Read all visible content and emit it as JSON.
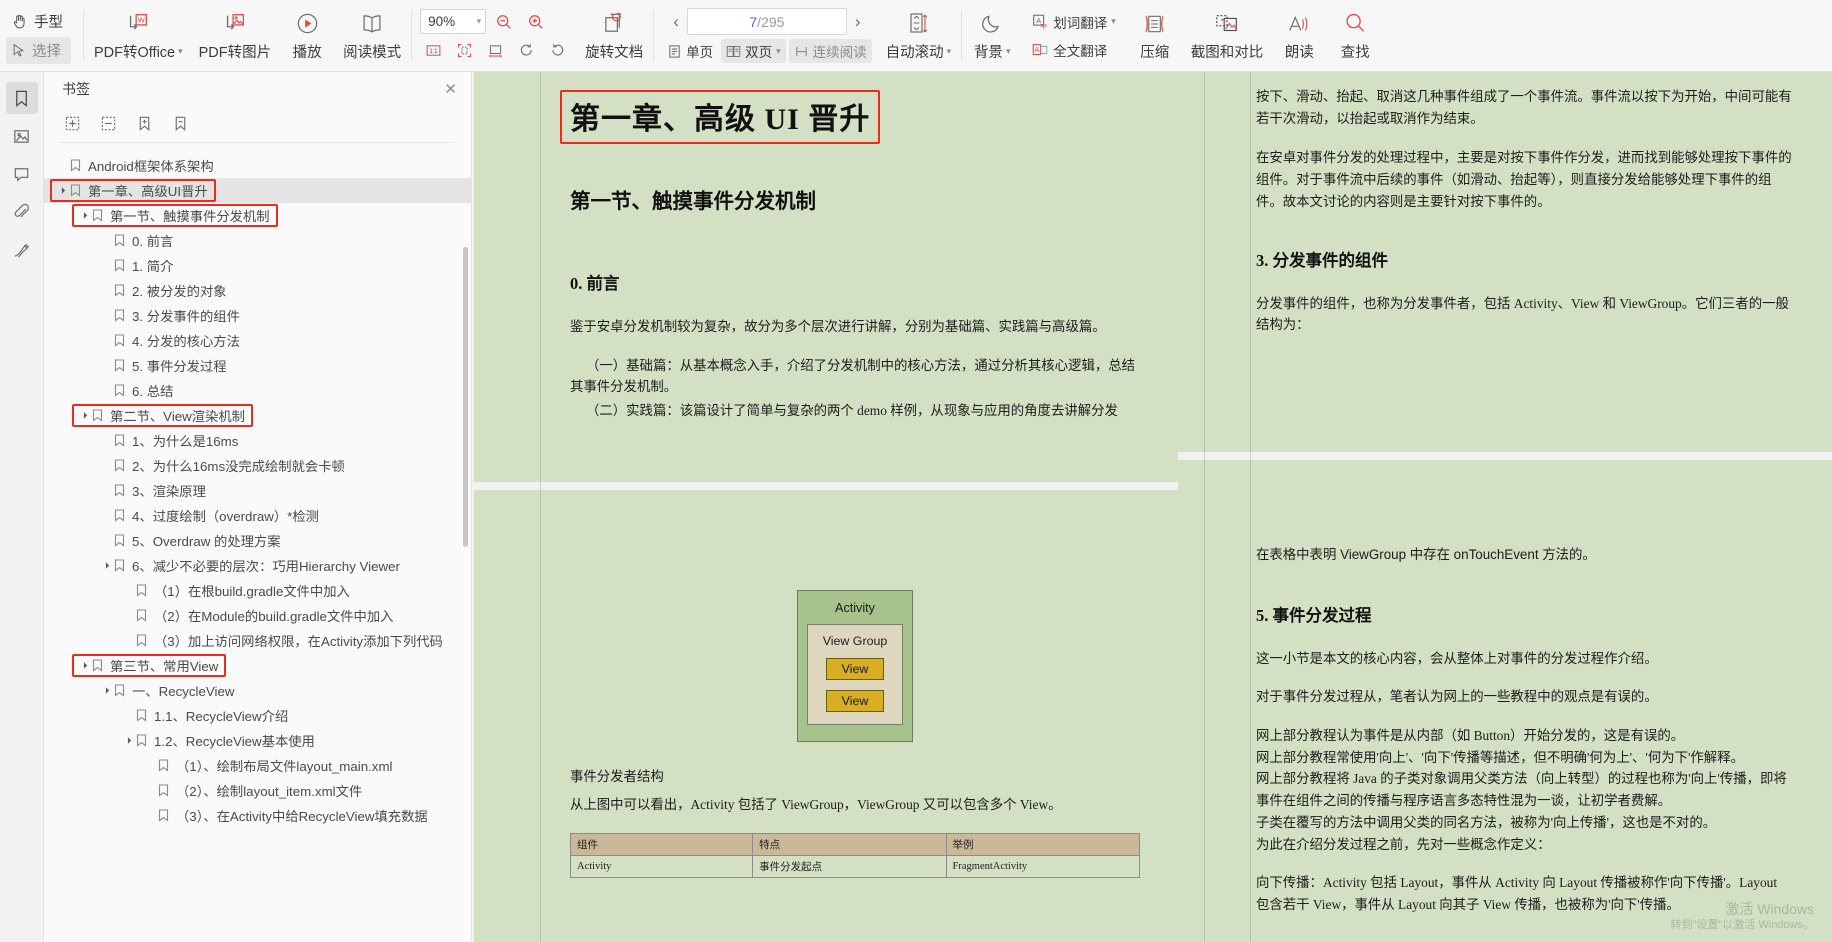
{
  "toolbar": {
    "mode_hand": "手型",
    "mode_select": "选择",
    "pdf_to_office": "PDF转Office",
    "pdf_to_image": "PDF转图片",
    "play": "播放",
    "read_mode": "阅读模式",
    "zoom_value": "90%",
    "zoom_out_title": "缩小",
    "zoom_in_title": "放大",
    "fit_actual": "1:1",
    "rotate_doc": "旋转文档",
    "page_current": "7",
    "page_separator": "/",
    "page_total": "295",
    "single_page": "单页",
    "double_page": "双页",
    "continuous_read": "连续阅读",
    "auto_scroll": "自动滚动",
    "background": "背景",
    "word_translate": "划词翻译",
    "full_translate": "全文翻译",
    "compress": "压缩",
    "screenshot_compare": "截图和对比",
    "read_aloud": "朗读",
    "find": "查找"
  },
  "rail": {
    "items": [
      {
        "name": "bookmark",
        "active": true
      },
      {
        "name": "thumbnail",
        "active": false
      },
      {
        "name": "comment",
        "active": false
      },
      {
        "name": "attachment",
        "active": false
      },
      {
        "name": "signature",
        "active": false
      }
    ]
  },
  "bookmark_panel": {
    "title": "书签",
    "close": "✕",
    "tools": [
      "expand-all",
      "collapse-all",
      "add-bookmark",
      "delete-bookmark"
    ],
    "items": [
      {
        "label": "Android框架体系架构",
        "indent": 0,
        "arrow": "",
        "selected": false,
        "highlight": false
      },
      {
        "label": "第一章、高级UI晋升",
        "indent": 0,
        "arrow": "▼",
        "selected": true,
        "highlight": true
      },
      {
        "label": "第一节、触摸事件分发机制",
        "indent": 1,
        "arrow": "▼",
        "selected": false,
        "highlight": true
      },
      {
        "label": "0. 前言",
        "indent": 2,
        "arrow": "",
        "selected": false,
        "highlight": false
      },
      {
        "label": "1. 简介",
        "indent": 2,
        "arrow": "",
        "selected": false,
        "highlight": false
      },
      {
        "label": "2. 被分发的对象",
        "indent": 2,
        "arrow": "",
        "selected": false,
        "highlight": false
      },
      {
        "label": "3. 分发事件的组件",
        "indent": 2,
        "arrow": "",
        "selected": false,
        "highlight": false
      },
      {
        "label": "4. 分发的核心方法",
        "indent": 2,
        "arrow": "",
        "selected": false,
        "highlight": false
      },
      {
        "label": "5. 事件分发过程",
        "indent": 2,
        "arrow": "",
        "selected": false,
        "highlight": false
      },
      {
        "label": "6. 总结",
        "indent": 2,
        "arrow": "",
        "selected": false,
        "highlight": false
      },
      {
        "label": "第二节、View渲染机制",
        "indent": 1,
        "arrow": "▼",
        "selected": false,
        "highlight": true
      },
      {
        "label": "1、为什么是16ms",
        "indent": 2,
        "arrow": "",
        "selected": false,
        "highlight": false
      },
      {
        "label": "2、为什么16ms没完成绘制就会卡顿",
        "indent": 2,
        "arrow": "",
        "selected": false,
        "highlight": false
      },
      {
        "label": "3、渲染原理",
        "indent": 2,
        "arrow": "",
        "selected": false,
        "highlight": false
      },
      {
        "label": "4、过度绘制（overdraw）*检测",
        "indent": 2,
        "arrow": "",
        "selected": false,
        "highlight": false
      },
      {
        "label": "5、Overdraw 的处理方案",
        "indent": 2,
        "arrow": "",
        "selected": false,
        "highlight": false
      },
      {
        "label": "6、减少不必要的层次：巧用Hierarchy Viewer",
        "indent": 2,
        "arrow": "▼",
        "selected": false,
        "highlight": false
      },
      {
        "label": "（1）在根build.gradle文件中加入",
        "indent": 3,
        "arrow": "",
        "selected": false,
        "highlight": false
      },
      {
        "label": "（2）在Module的build.gradle文件中加入",
        "indent": 3,
        "arrow": "",
        "selected": false,
        "highlight": false
      },
      {
        "label": "（3）加上访问网络权限，在Activity添加下列代码",
        "indent": 3,
        "arrow": "",
        "selected": false,
        "highlight": false
      },
      {
        "label": "第三节、常用View",
        "indent": 1,
        "arrow": "▼",
        "selected": false,
        "highlight": true
      },
      {
        "label": "一、RecycleView",
        "indent": 2,
        "arrow": "▼",
        "selected": false,
        "highlight": false
      },
      {
        "label": "1.1、RecycleView介绍",
        "indent": 3,
        "arrow": "",
        "selected": false,
        "highlight": false
      },
      {
        "label": "1.2、RecycleView基本使用",
        "indent": 3,
        "arrow": "▼",
        "selected": false,
        "highlight": false
      },
      {
        "label": "（1）、绘制布局文件layout_main.xml",
        "indent": 4,
        "arrow": "",
        "selected": false,
        "highlight": false
      },
      {
        "label": "（2）、绘制layout_item.xml文件",
        "indent": 4,
        "arrow": "",
        "selected": false,
        "highlight": false
      },
      {
        "label": "（3）、在Activity中给RecycleView填充数据",
        "indent": 4,
        "arrow": "",
        "selected": false,
        "highlight": false
      }
    ]
  },
  "document": {
    "left_page": {
      "chapter_title": "第一章、高级 UI 晋升",
      "section_title": "第一节、触摸事件分发机制",
      "heading_0": "0.  前言",
      "para_1": "鉴于安卓分发机制较为复杂，故分为多个层次进行讲解，分别为基础篇、实践篇与高级篇。",
      "para_2": "（一）基础篇：从基本概念入手，介绍了分发机制中的核心方法，通过分析其核心逻辑，总结其事件分发机制。",
      "para_3": "（二）实践篇：该篇设计了简单与复杂的两个 demo 样例，从现象与应用的角度去讲解分发",
      "diagram": {
        "activity_label": "Activity",
        "viewgroup_label": "View Group",
        "view_label_1": "View",
        "view_label_2": "View"
      },
      "caption": "事件分发者结构",
      "para_4": "从上图中可以看出，Activity 包括了 ViewGroup，ViewGroup 又可以包含多个 View。",
      "table": {
        "headers": [
          "组件",
          "特点",
          "举例"
        ],
        "rows": [
          [
            "Activity",
            "事件分发起点",
            "FragmentActivity"
          ]
        ]
      }
    },
    "right_page": {
      "para_1": "按下、滑动、抬起、取消这几种事件组成了一个事件流。事件流以按下为开始，中间可能有若干次滑动，以抬起或取消作为结束。",
      "para_2": "在安卓对事件分发的处理过程中，主要是对按下事件作分发，进而找到能够处理按下事件的组件。对于事件流中后续的事件（如滑动、抬起等），则直接分发给能够处理下事件的组件。故本文讨论的内容则是主要针对按下事件的。",
      "heading_3": "3.  分发事件的组件",
      "para_3": "分发事件的组件，也称为分发事件者，包括 Activity、View 和 ViewGroup。它们三者的一般结构为：",
      "para_4": "在表格中表明 ViewGroup 中存在 onTouchEvent 方法的。",
      "heading_5": "5.  事件分发过程",
      "para_5": "这一小节是本文的核心内容，会从整体上对事件的分发过程作介绍。",
      "para_6": "对于事件分发过程从，笔者认为网上的一些教程中的观点是有误的。",
      "para_7": "网上部分教程认为事件是从内部（如 Button）开始分发的，这是有误的。",
      "para_8": "网上部分教程常使用'向上'、'向下'传播等描述，但不明确'何为上'、'何为下'作解释。",
      "para_9": "网上部分教程将 Java 的子类对象调用父类方法（向上转型）的过程也称为'向上'传播，即将",
      "para_10": "事件在组件之间的传播与程序语言多态特性混为一谈，让初学者费解。",
      "para_11": "子类在覆写的方法中调用父类的同名方法，被称为'向上传播'，这也是不对的。",
      "para_12": "为此在介绍分发过程之前，先对一些概念作定义：",
      "para_13": "向下传播：Activity 包括 Layout，事件从 Activity 向 Layout 传播被称作'向下传播'。Layout 包含若干 View，事件从 Layout 向其子 View 传播，也被称为'向下'传播。"
    }
  },
  "watermark": {
    "line1": "激活 Windows",
    "line2": "转到\"设置\"以激活 Windows。"
  },
  "colors": {
    "page_bg": "#d3e0c3",
    "toolbar_bg": "#f7f7f7",
    "accent_red": "#e04a45",
    "highlight_red": "#ea2b1f",
    "selection_gray": "#e4e4e4",
    "diagram_activity": "#a7c38c",
    "diagram_viewgroup": "#ddd8bd",
    "diagram_view": "#d9af22",
    "page_number_blue": "#4b6bb5"
  }
}
